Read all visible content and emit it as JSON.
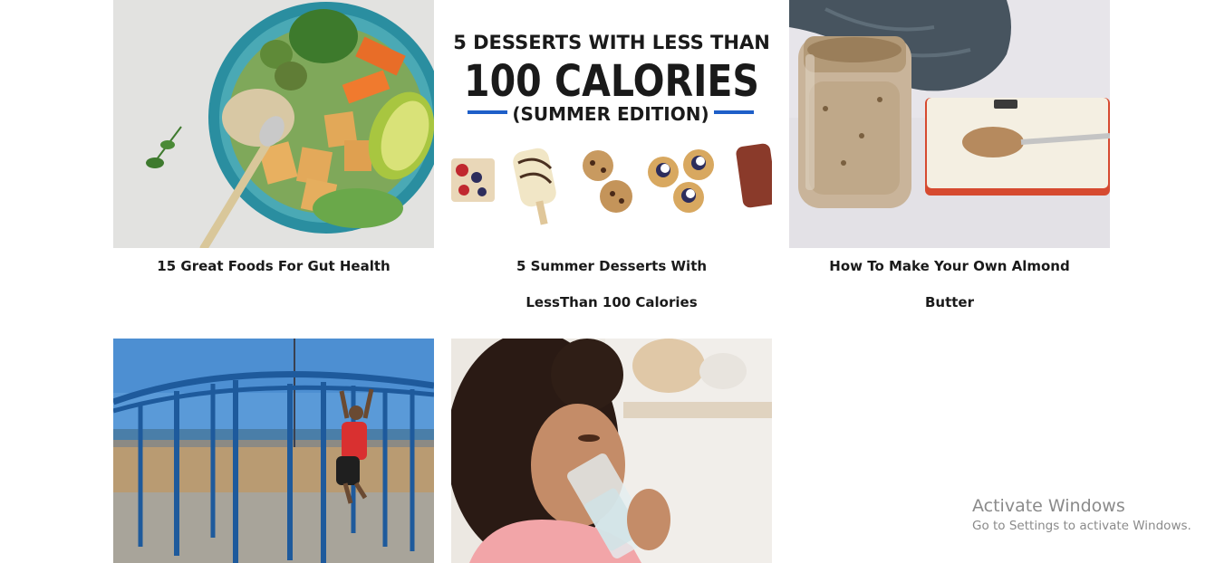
{
  "articles": [
    {
      "title": "15 Great Foods For Gut Health",
      "image": "buddha-bowl-image"
    },
    {
      "title": "5 Summer Desserts With LessThan 100 Calories",
      "image": "summer-desserts-image",
      "image_text": {
        "line1": "5 DESSERTS WITH LESS THAN",
        "line2": "100 CALORIES",
        "line3": "(SUMMER EDITION)"
      }
    },
    {
      "title": "How To Make Your Own Almond Butter",
      "image": "almond-butter-jar-image"
    },
    {
      "title": "",
      "image": "outdoor-pullup-image"
    },
    {
      "title": "",
      "image": "woman-drinking-water-image"
    }
  ],
  "watermark": {
    "line1": "Activate Windows",
    "line2": "Go to Settings to activate Windows."
  }
}
